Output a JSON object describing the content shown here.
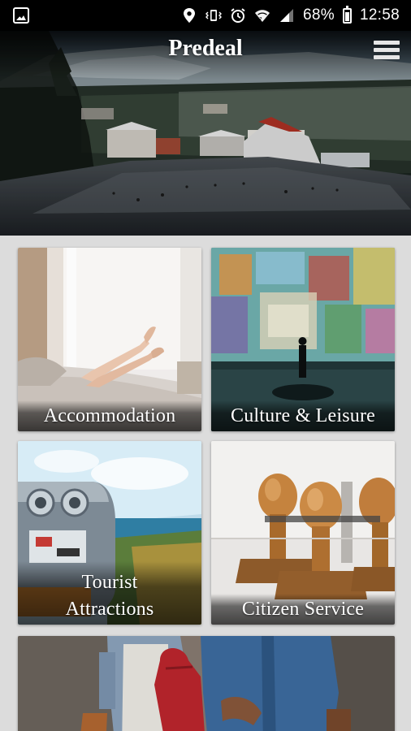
{
  "status_bar": {
    "battery_percent": "68%",
    "time": "12:58",
    "icons": [
      "image-icon",
      "location-icon",
      "vibrate-icon",
      "alarm-icon",
      "wifi-icon",
      "signal-icon",
      "battery-icon"
    ]
  },
  "header": {
    "title": "Predeal",
    "menu_icon": "hamburger-menu-icon"
  },
  "tiles": [
    {
      "label_lines": [
        "Accommodation"
      ]
    },
    {
      "label_lines": [
        "Culture & Leisure"
      ]
    },
    {
      "label_lines": [
        "Tourist",
        "Attractions"
      ]
    },
    {
      "label_lines": [
        "Citizen Service"
      ]
    },
    {
      "label_lines": []
    }
  ],
  "colors": {
    "status_bar": "#000000",
    "page_background": "#dcdcdc",
    "label_text": "#ffffff"
  }
}
